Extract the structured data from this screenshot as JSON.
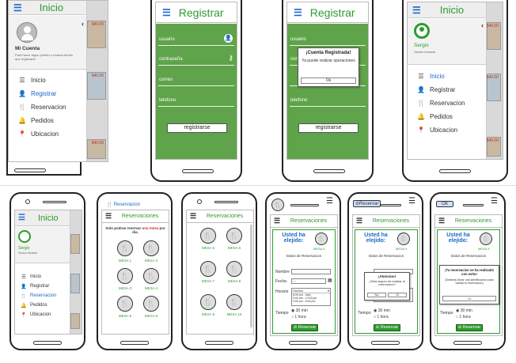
{
  "colors": {
    "accent_green": "#2e9b2e",
    "form_green": "#5fa34a",
    "link_blue": "#1b67c9"
  },
  "menu": {
    "home": "Inicio",
    "register": "Registrar",
    "reservation": "Reservacion",
    "orders": "Pedidos",
    "location": "Ubicacion"
  },
  "profile": {
    "guest_name": "Mi Cuenta",
    "guest_hint": "Para hacer algun pedido o realizar tienes que registrarte",
    "user_name": "Sergio",
    "user_status": "Sesion iniciada"
  },
  "register_form": {
    "title": "Registrar",
    "username": "usuario",
    "password": "contraseña",
    "email": "correo",
    "phone": "telefono",
    "submit": "registrarse"
  },
  "register_dialog": {
    "title": "¡Cuenta Registrada!",
    "text": "Ya puede realizar operaciones",
    "ok": "Ok"
  },
  "reservations": {
    "title": "Reservaciones",
    "header_link": "Reservacion",
    "note_prefix": "Solo podras reservar",
    "note_highlight": "una mesa",
    "note_suffix": "por dia.",
    "tables_a": [
      "MESA 1",
      "MESA 2",
      "MESA 3",
      "MESA 4",
      "MESA 5",
      "MESA 6"
    ],
    "tables_b": [
      "MESA 5",
      "MESA 6",
      "MESA 7",
      "MESA 8",
      "MESA 9",
      "MESA 10"
    ]
  },
  "reservation_form": {
    "chosen_title": "Usted ha elejido:",
    "chosen_table": "MESA 5",
    "data_title": "Datos de Reservacion",
    "name_label": "Nombre",
    "date_label": "Fecha",
    "date_value": "/ / ",
    "time_label": "Horario",
    "time_value": "Horario",
    "time_opt1": "6:00 am - 9am",
    "time_opt2": "9:00 am - 12:00 pm",
    "time_opt3": "3:00 pm - 6:00 pm",
    "duration_label": "Tiempo",
    "duration_opt1": "30 min",
    "duration_opt2": "1 hora",
    "submit": "Reservar",
    "top_chip": "Reservar",
    "confirm_title": "¡Atencion!",
    "confirm_text": "¿Esta seguro de realizar la reservacion?",
    "confirm_no": "No",
    "confirm_yes": "Si",
    "success_title": "¡Tu reservacion se ha realizado con exito!",
    "success_text": "(Deberas llevar una identificacion para validar tu reservacion)",
    "success_ok": "Ok",
    "success_chip": "Ok"
  }
}
